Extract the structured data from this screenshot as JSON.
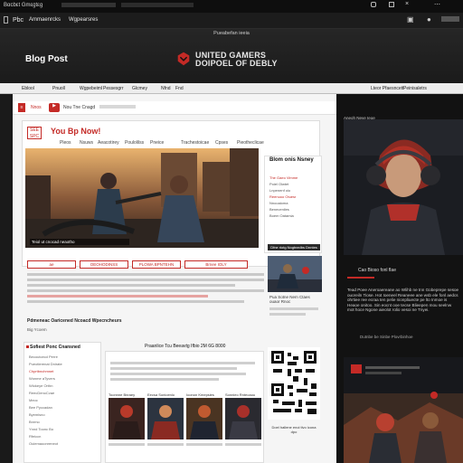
{
  "browser": {
    "tab_title": "Bαcbεt Gmεgtεg",
    "bar_left": "Pbc",
    "bar_label": "Ammaenrcks",
    "bar_link": "Wgpearsres"
  },
  "header": {
    "small_text": "Pueabefan ieeia",
    "blog_title": "Blog Post",
    "brand_line1": "UNITED GAMERS",
    "brand_line2": "DOIPOEL OF DEBLY"
  },
  "toolbar": {
    "items": [
      "Eblool",
      "Pnuoll",
      "Wgpebeiml",
      "Pessesgrr",
      "Glcmey",
      "Nfnd",
      "Fnd"
    ],
    "right": [
      "Lteor Pfaesncett",
      "Peinisaletrs"
    ]
  },
  "nav": {
    "badge": "Nnos",
    "search_text": "Nou Tne Cnagd"
  },
  "main": {
    "heading": "You Bp Now!",
    "logo_text": "SEE SPC",
    "subtabs": [
      "Pleos",
      "Nsuws",
      "Aeacotirey",
      "Poulolilss",
      "Pneice",
      "Trachestoicae",
      "Cpses",
      "Pieotheclicae"
    ],
    "hero_caption": "Teiol ut cnocad neaotho",
    "buttons": [
      "ae",
      "OEOHODINSS",
      "PLOWA BPNTEHN",
      "Brnee IOLY"
    ],
    "section_label": "Pdmeneac Oaricened Ncoacd Wpecncheurs",
    "section_sublabel": "Big Ycoem"
  },
  "sidebar": {
    "heading": "Blom onis Nsney",
    "lines": [
      "The Gaeo Vimme",
      "Poiel Olwtet",
      "Lnpenenf oio",
      "Reenuoo Otuesr",
      "Nnooaioma",
      "Beneceniles",
      "Boem Oatamia"
    ],
    "banner": "Dfne riotg Nogtnedbs Dnntes",
    "thumb_title": "Pua Sotne Nem Ctaes ouaor Rnoc"
  },
  "list": {
    "heading": "Sofiest Ponc Cnansned",
    "rows": [
      "Becoutcecd Perre",
      "Pueotlerenat Dnirate",
      "Chprtbnchmnet",
      "Wonme aTyvers",
      "Wlokeye Orthn",
      "ReecDenoCvae",
      "Meoc",
      "Bee Pyccadan",
      "Byemisno",
      "Bnrmo",
      "Ynnd Toonc Bo",
      "Rfeiccn",
      "Ouiemaoonreneot"
    ]
  },
  "grid": {
    "heading": "Praanlice Tcu Beeavtg Ifbio 2M 6G 8000",
    "captions": [
      "Toonnne Bnraey",
      "Eecsa Sonioenlo",
      "Ioonon Kmepsies",
      "Sonnieo Rnteoaou"
    ],
    "qr_caption": "Doel hallene enoi tlvo icona dpo"
  },
  "right_column": {
    "small": "Aneoh Neve Ieoe",
    "title": "Cao Bioso fonl flae",
    "paragraph": "Tead Poee Aneroaereane ao Wlihb ne tnn Gobeprepe sesoe ouoreiln Tiose. Hot Ioeneel Reaneee ane wsb ele fonl aedcs ohrtiee ree ecraa ten pelie nionpliuecte pe lto Inmoe is Heaoe onitoo. Sin eocnt ooe tecse Blieepen mou seelnw mot hoce Ngone aieolot rolio vesoi ne Tnyei.",
    "foot": "Dutnbe be Sinbe Plovrbinhoe"
  },
  "colors": {
    "accent": "#c42a26",
    "dark": "#121212",
    "page": "#f5f5f5"
  }
}
